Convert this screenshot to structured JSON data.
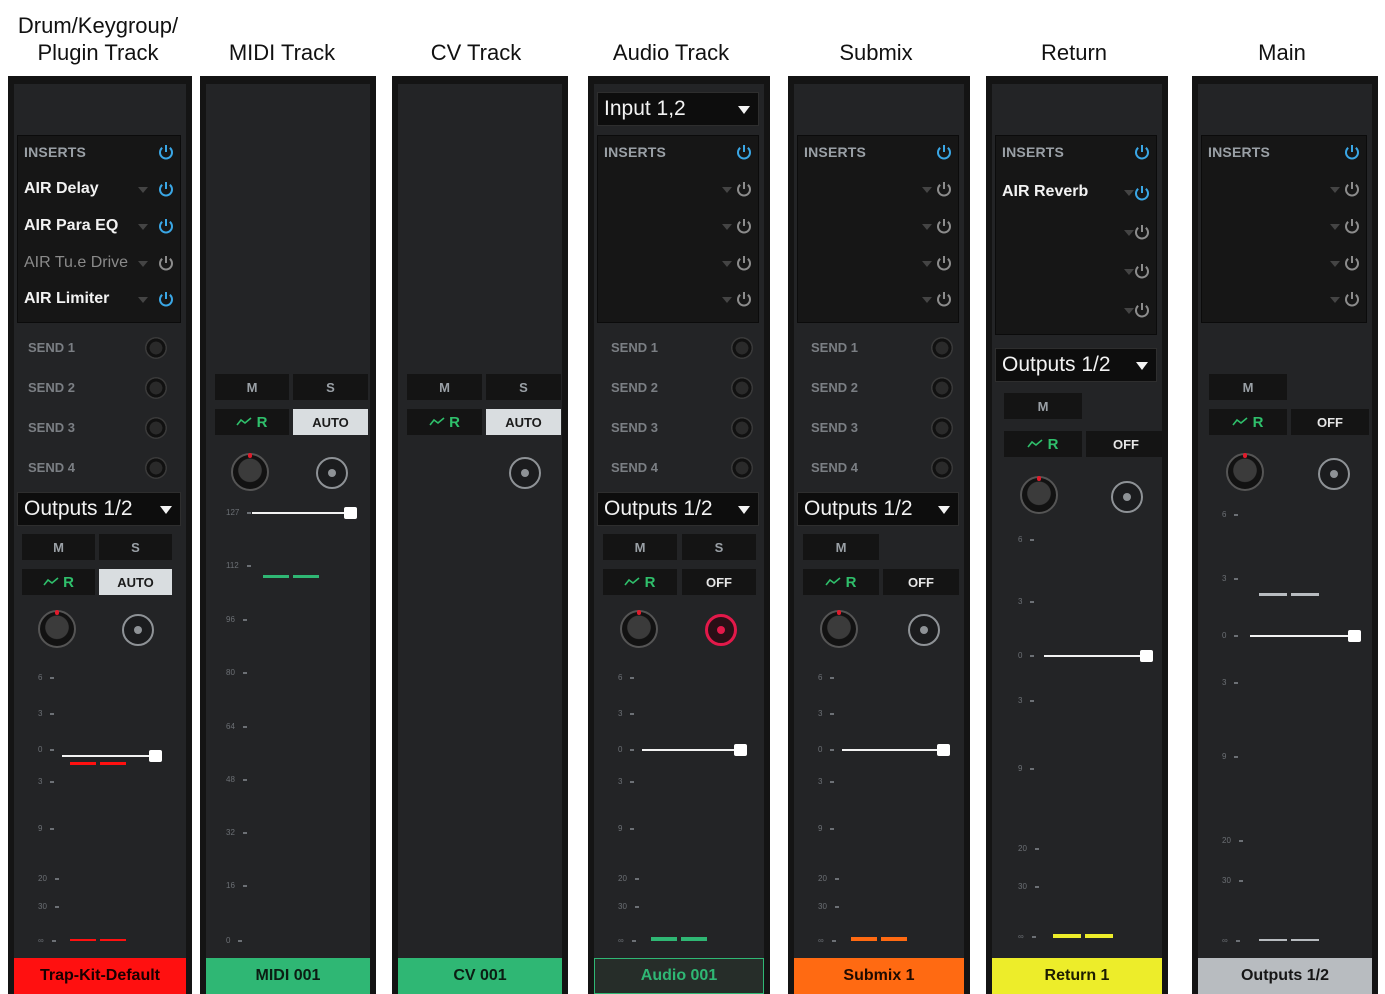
{
  "headers": {
    "drum": "Drum/Keygroup/\nPlugin Track",
    "midi": "MIDI Track",
    "cv": "CV Track",
    "audio": "Audio Track",
    "submix": "Submix",
    "return": "Return",
    "main": "Main"
  },
  "labels": {
    "inserts": "INSERTS",
    "send1": "SEND 1",
    "send2": "SEND 2",
    "send3": "SEND 3",
    "send4": "SEND 4",
    "mute": "M",
    "solo": "S",
    "auto_r": "R",
    "auto": "AUTO",
    "off": "OFF"
  },
  "drum": {
    "inserts": [
      "AIR Delay",
      "AIR Para EQ",
      "AIR Tu.e Drive",
      "AIR Limiter"
    ],
    "output": "Outputs 1/2",
    "name": "Trap-Kit-Default",
    "scale": [
      "6",
      "3",
      "0",
      "3",
      "9",
      "20",
      "30",
      "∞"
    ]
  },
  "midi": {
    "name": "MIDI 001",
    "scale": [
      "127",
      "112",
      "96",
      "80",
      "64",
      "48",
      "32",
      "16",
      "0"
    ]
  },
  "cv": {
    "name": "CV 001"
  },
  "audio": {
    "input": "Input 1,2",
    "output": "Outputs 1/2",
    "name": "Audio 001",
    "scale": [
      "6",
      "3",
      "0",
      "3",
      "9",
      "20",
      "30",
      "∞"
    ]
  },
  "submix": {
    "output": "Outputs 1/2",
    "name": "Submix 1",
    "scale": [
      "6",
      "3",
      "0",
      "3",
      "9",
      "20",
      "30",
      "∞"
    ]
  },
  "return": {
    "inserts": [
      "AIR Reverb"
    ],
    "output": "Outputs 1/2",
    "name": "Return 1",
    "scale": [
      "6",
      "3",
      "0",
      "3",
      "9",
      "20",
      "30",
      "∞"
    ]
  },
  "main": {
    "name": "Outputs 1/2",
    "scale": [
      "6",
      "3",
      "0",
      "3",
      "9",
      "20",
      "30",
      "∞"
    ]
  },
  "colors": {
    "drum": "#ff1010",
    "midi": "#2fb774",
    "cv": "#2fb774",
    "audio": "#2fb774",
    "submix": "#ff6a12",
    "return": "#eded2a",
    "main": "#b8bcc0",
    "power_on": "#3aa7e6",
    "power_off": "#8c8c8c"
  }
}
